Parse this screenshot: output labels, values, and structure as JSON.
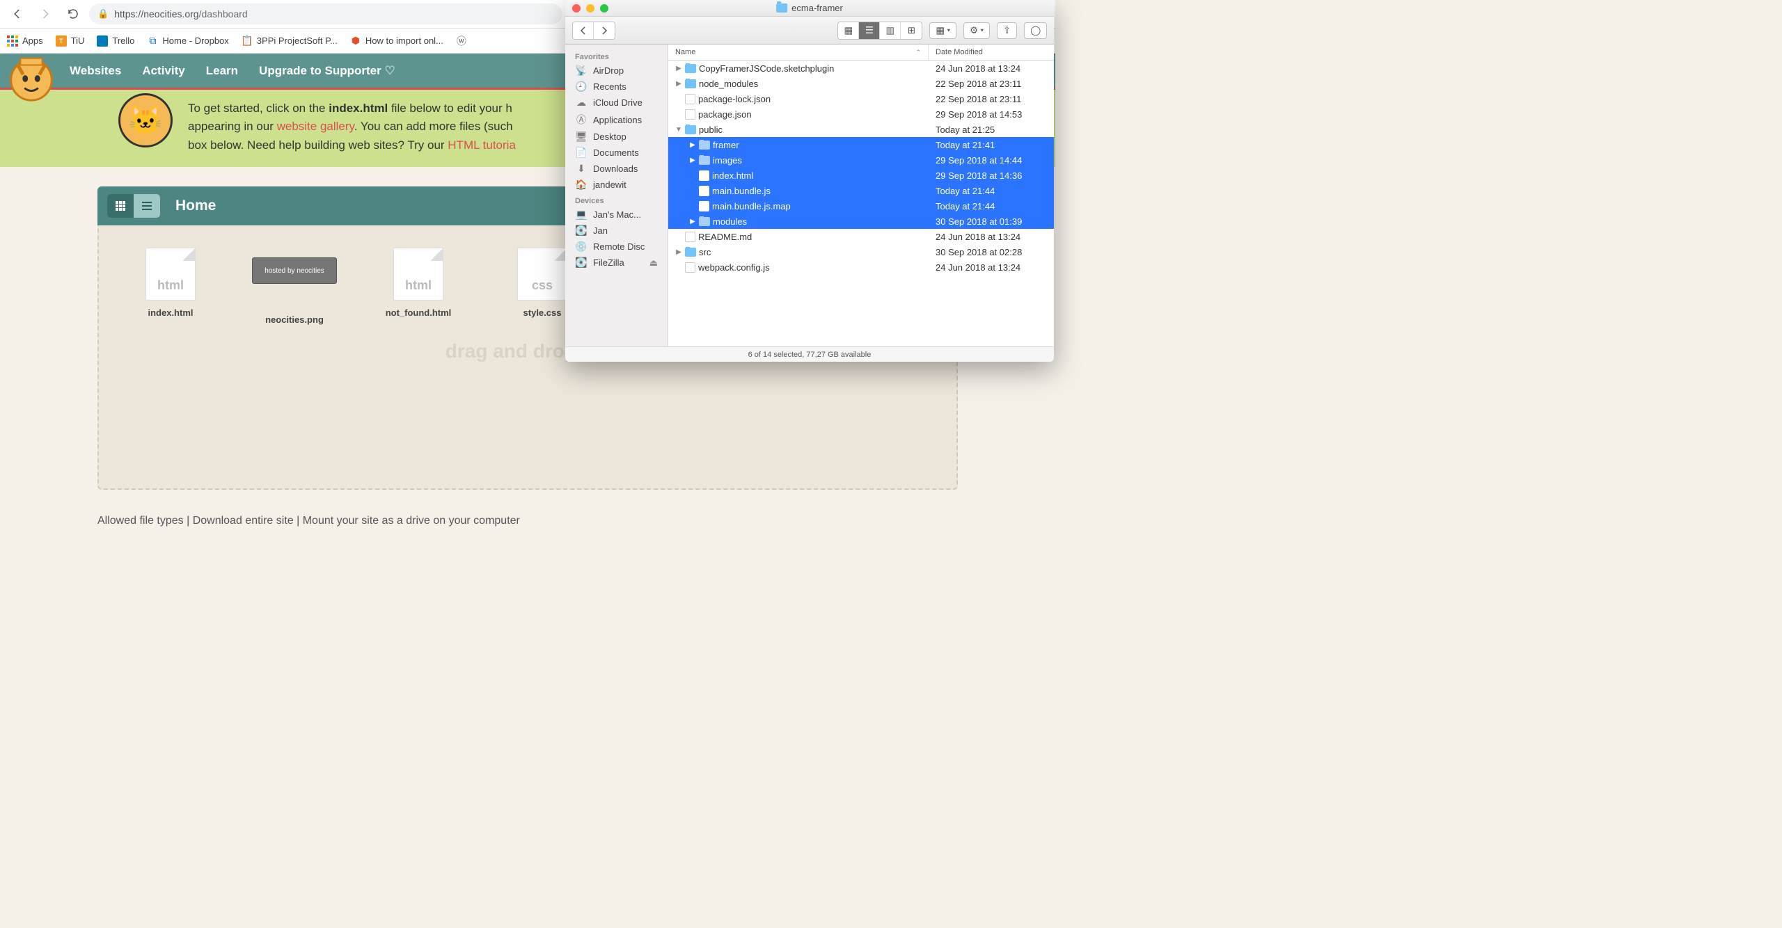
{
  "browser": {
    "url_scheme": "https://",
    "url_host": "neocities.org",
    "url_path": "/dashboard",
    "bookmarks": [
      {
        "label": "Apps",
        "icon": "apps"
      },
      {
        "label": "TiU",
        "icon": "tiu"
      },
      {
        "label": "Trello",
        "icon": "trello"
      },
      {
        "label": "Home - Dropbox",
        "icon": "dropbox"
      },
      {
        "label": "3PPi ProjectSoft P...",
        "icon": "project"
      },
      {
        "label": "How to import onl...",
        "icon": "html5"
      },
      {
        "label": "",
        "icon": "wordpress"
      }
    ]
  },
  "neocities": {
    "nav": {
      "websites": "Websites",
      "activity": "Activity",
      "learn": "Learn",
      "upgrade": "Upgrade to Supporter"
    },
    "hint": {
      "pre": "To get started, click on the ",
      "bold_file": "index.html",
      "mid1": " file below to edit your h",
      "mid2": "appearing in our ",
      "link1": "website gallery",
      "mid3": ". You can add more files (such ",
      "mid4": "box below. Need help building web sites? Try our ",
      "link2": "HTML tutoria"
    },
    "panel_title": "Home",
    "files": [
      {
        "name": "index.html",
        "ext": "html",
        "type": "file"
      },
      {
        "name": "neocities.png",
        "ext": "",
        "type": "image"
      },
      {
        "name": "not_found.html",
        "ext": "html",
        "type": "file"
      },
      {
        "name": "style.css",
        "ext": "css",
        "type": "file"
      }
    ],
    "drop_hint": "drag and drop file",
    "footer": {
      "allowed": "Allowed file types",
      "download": "Download entire site",
      "mount": "Mount your site as a drive on your computer",
      "sep": " | "
    }
  },
  "finder": {
    "title": "ecma-framer",
    "sidebar": {
      "favorites_header": "Favorites",
      "favorites": [
        {
          "label": "AirDrop",
          "icon": "📡"
        },
        {
          "label": "Recents",
          "icon": "🕘"
        },
        {
          "label": "iCloud Drive",
          "icon": "☁"
        },
        {
          "label": "Applications",
          "icon": "Ⓐ"
        },
        {
          "label": "Desktop",
          "icon": "🖥"
        },
        {
          "label": "Documents",
          "icon": "📄"
        },
        {
          "label": "Downloads",
          "icon": "⬇"
        },
        {
          "label": "jandewit",
          "icon": "🏠"
        }
      ],
      "devices_header": "Devices",
      "devices": [
        {
          "label": "Jan's Mac...",
          "icon": "💻"
        },
        {
          "label": "Jan",
          "icon": "💽"
        },
        {
          "label": "Remote Disc",
          "icon": "💿"
        },
        {
          "label": "FileZilla",
          "icon": "💽",
          "eject": true
        }
      ]
    },
    "columns": {
      "name": "Name",
      "date": "Date Modified"
    },
    "rows": [
      {
        "name": "CopyFramerJSCode.sketchplugin",
        "date": "24 Jun 2018 at 13:24",
        "type": "folder",
        "indent": 0,
        "disclosure": "▶",
        "selected": false
      },
      {
        "name": "node_modules",
        "date": "22 Sep 2018 at 23:11",
        "type": "folder",
        "indent": 0,
        "disclosure": "▶",
        "selected": false
      },
      {
        "name": "package-lock.json",
        "date": "22 Sep 2018 at 23:11",
        "type": "file",
        "indent": 0,
        "disclosure": "",
        "selected": false
      },
      {
        "name": "package.json",
        "date": "29 Sep 2018 at 14:53",
        "type": "file",
        "indent": 0,
        "disclosure": "",
        "selected": false
      },
      {
        "name": "public",
        "date": "Today at 21:25",
        "type": "folder",
        "indent": 0,
        "disclosure": "▼",
        "selected": false
      },
      {
        "name": "framer",
        "date": "Today at 21:41",
        "type": "folder",
        "indent": 1,
        "disclosure": "▶",
        "selected": true
      },
      {
        "name": "images",
        "date": "29 Sep 2018 at 14:44",
        "type": "folder",
        "indent": 1,
        "disclosure": "▶",
        "selected": true
      },
      {
        "name": "index.html",
        "date": "29 Sep 2018 at 14:36",
        "type": "file",
        "indent": 1,
        "disclosure": "",
        "selected": true
      },
      {
        "name": "main.bundle.js",
        "date": "Today at 21:44",
        "type": "file",
        "indent": 1,
        "disclosure": "",
        "selected": true
      },
      {
        "name": "main.bundle.js.map",
        "date": "Today at 21:44",
        "type": "file",
        "indent": 1,
        "disclosure": "",
        "selected": true
      },
      {
        "name": "modules",
        "date": "30 Sep 2018 at 01:39",
        "type": "folder",
        "indent": 1,
        "disclosure": "▶",
        "selected": true
      },
      {
        "name": "README.md",
        "date": "24 Jun 2018 at 13:24",
        "type": "file",
        "indent": 0,
        "disclosure": "",
        "selected": false
      },
      {
        "name": "src",
        "date": "30 Sep 2018 at 02:28",
        "type": "folder",
        "indent": 0,
        "disclosure": "▶",
        "selected": false
      },
      {
        "name": "webpack.config.js",
        "date": "24 Jun 2018 at 13:24",
        "type": "file",
        "indent": 0,
        "disclosure": "",
        "selected": false
      }
    ],
    "status": "6 of 14 selected, 77,27 GB available"
  }
}
